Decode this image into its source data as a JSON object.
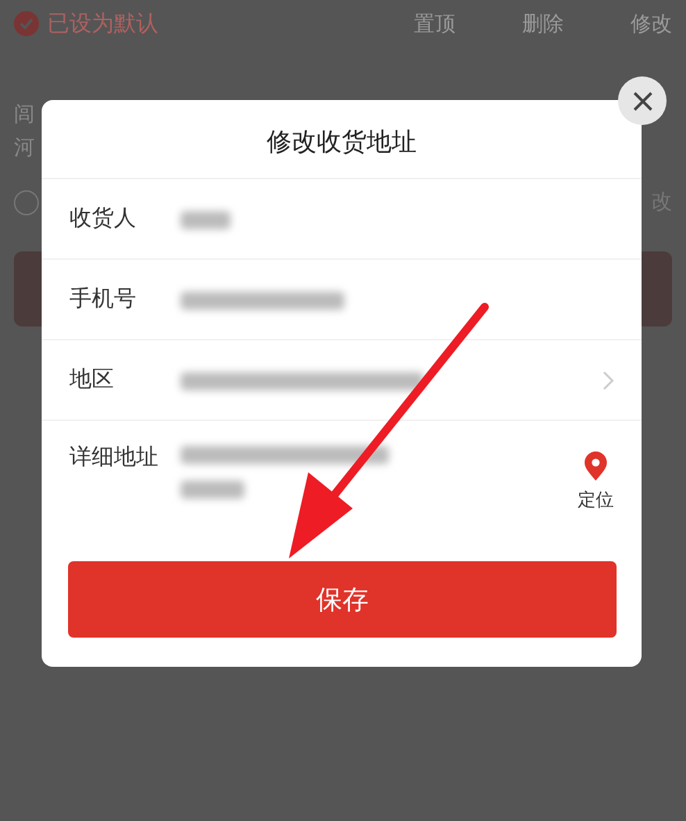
{
  "background": {
    "default_label": "已设为默认",
    "default_checked": true,
    "actions": [
      "置顶",
      "删除",
      "修改"
    ],
    "address_lines": [
      "闾",
      "河"
    ],
    "radio_checked": false,
    "edit_fragment": "改"
  },
  "dialog": {
    "title": "修改收货地址",
    "fields": [
      {
        "label": "收货人",
        "kind": "text"
      },
      {
        "label": "手机号",
        "kind": "text"
      },
      {
        "label": "地区",
        "kind": "picker"
      },
      {
        "label": "详细地址",
        "kind": "locate",
        "action": "定位"
      }
    ],
    "save": "保存"
  }
}
